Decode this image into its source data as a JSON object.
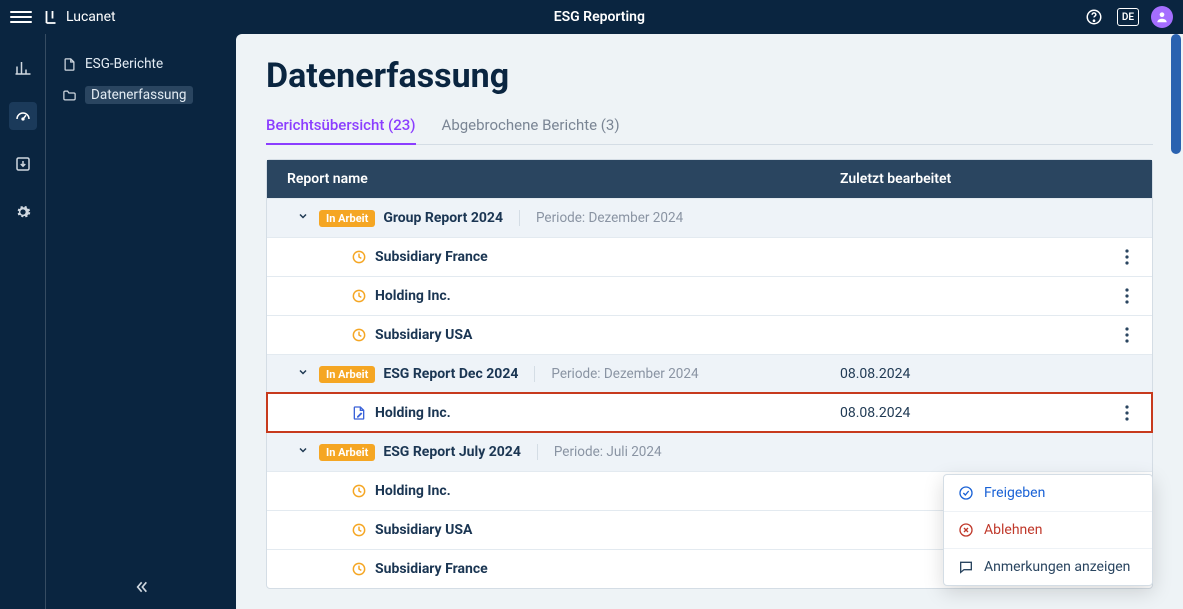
{
  "header": {
    "brand": "Lucanet",
    "title": "ESG Reporting",
    "lang": "DE"
  },
  "sidebar": {
    "items": [
      {
        "icon": "file",
        "label": "ESG-Berichte"
      },
      {
        "icon": "folder",
        "label": "Datenerfassung"
      }
    ]
  },
  "page": {
    "title": "Datenerfassung"
  },
  "tabs": {
    "overview_label": "Berichtsübersicht (23)",
    "aborted_label": "Abgebrochene Berichte (3)"
  },
  "columns": {
    "name": "Report name",
    "date": "Zuletzt bearbeitet"
  },
  "badge_text": "In Arbeit",
  "period_prefix": "Periode: ",
  "rows": [
    {
      "type": "parent",
      "name": "Group Report 2024",
      "period": "Dezember 2024",
      "date": ""
    },
    {
      "type": "child-clock",
      "name": "Subsidiary France",
      "date": ""
    },
    {
      "type": "child-clock",
      "name": "Holding Inc.",
      "date": ""
    },
    {
      "type": "child-clock",
      "name": "Subsidiary USA",
      "date": ""
    },
    {
      "type": "parent",
      "name": "ESG Report Dec 2024",
      "period": "Dezember 2024",
      "date": "08.08.2024"
    },
    {
      "type": "child-doc",
      "name": "Holding Inc.",
      "date": "08.08.2024",
      "highlight": true
    },
    {
      "type": "parent",
      "name": "ESG Report July 2024",
      "period": "Juli 2024",
      "date": ""
    },
    {
      "type": "child-clock",
      "name": "Holding Inc.",
      "date": ""
    },
    {
      "type": "child-clock",
      "name": "Subsidiary USA",
      "date": ""
    },
    {
      "type": "child-clock",
      "name": "Subsidiary France",
      "date": ""
    }
  ],
  "menu": {
    "approve": "Freigeben",
    "reject": "Ablehnen",
    "notes": "Anmerkungen anzeigen"
  }
}
